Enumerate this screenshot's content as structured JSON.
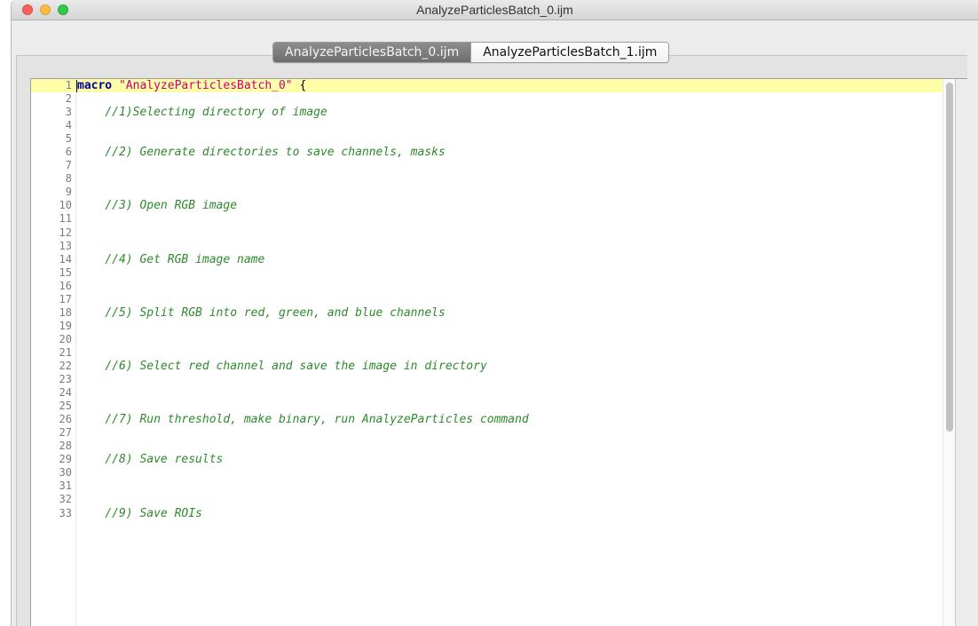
{
  "window": {
    "title": "AnalyzeParticlesBatch_0.ijm"
  },
  "tabs": [
    {
      "label": "AnalyzeParticlesBatch_0.ijm",
      "active": true
    },
    {
      "label": "AnalyzeParticlesBatch_1.ijm",
      "active": false
    }
  ],
  "editor": {
    "current_line": 1,
    "lines": [
      {
        "n": "1",
        "keyword": "macro",
        "string": "\"AnalyzeParticlesBatch_0\"",
        "text": " {"
      },
      {
        "n": "2",
        "comment": ""
      },
      {
        "n": "3",
        "comment": "//1)Selecting directory of image"
      },
      {
        "n": "4",
        "comment": ""
      },
      {
        "n": "5",
        "comment": ""
      },
      {
        "n": "6",
        "comment": "//2) Generate directories to save channels, masks"
      },
      {
        "n": "7",
        "comment": ""
      },
      {
        "n": "8",
        "comment": ""
      },
      {
        "n": "9",
        "comment": ""
      },
      {
        "n": "10",
        "comment": "//3) Open RGB image"
      },
      {
        "n": "11",
        "comment": ""
      },
      {
        "n": "12",
        "comment": ""
      },
      {
        "n": "13",
        "comment": ""
      },
      {
        "n": "14",
        "comment": "//4) Get RGB image name"
      },
      {
        "n": "15",
        "comment": ""
      },
      {
        "n": "16",
        "comment": ""
      },
      {
        "n": "17",
        "comment": ""
      },
      {
        "n": "18",
        "comment": "//5) Split RGB into red, green, and blue channels"
      },
      {
        "n": "19",
        "comment": ""
      },
      {
        "n": "20",
        "comment": ""
      },
      {
        "n": "21",
        "comment": ""
      },
      {
        "n": "22",
        "comment": "//6) Select red channel and save the image in directory"
      },
      {
        "n": "23",
        "comment": ""
      },
      {
        "n": "24",
        "comment": ""
      },
      {
        "n": "25",
        "comment": ""
      },
      {
        "n": "26",
        "comment": "//7) Run threshold, make binary, run AnalyzeParticles command"
      },
      {
        "n": "27",
        "comment": ""
      },
      {
        "n": "28",
        "comment": ""
      },
      {
        "n": "29",
        "comment": "//8) Save results"
      },
      {
        "n": "30",
        "comment": ""
      },
      {
        "n": "31",
        "comment": ""
      },
      {
        "n": "32",
        "comment": ""
      },
      {
        "n": "33",
        "comment": "//9) Save ROIs"
      }
    ]
  },
  "colors": {
    "keyword": "#00009c",
    "string": "#c8007a",
    "comment": "#2d8a2d",
    "current_line": "#fefea8"
  }
}
